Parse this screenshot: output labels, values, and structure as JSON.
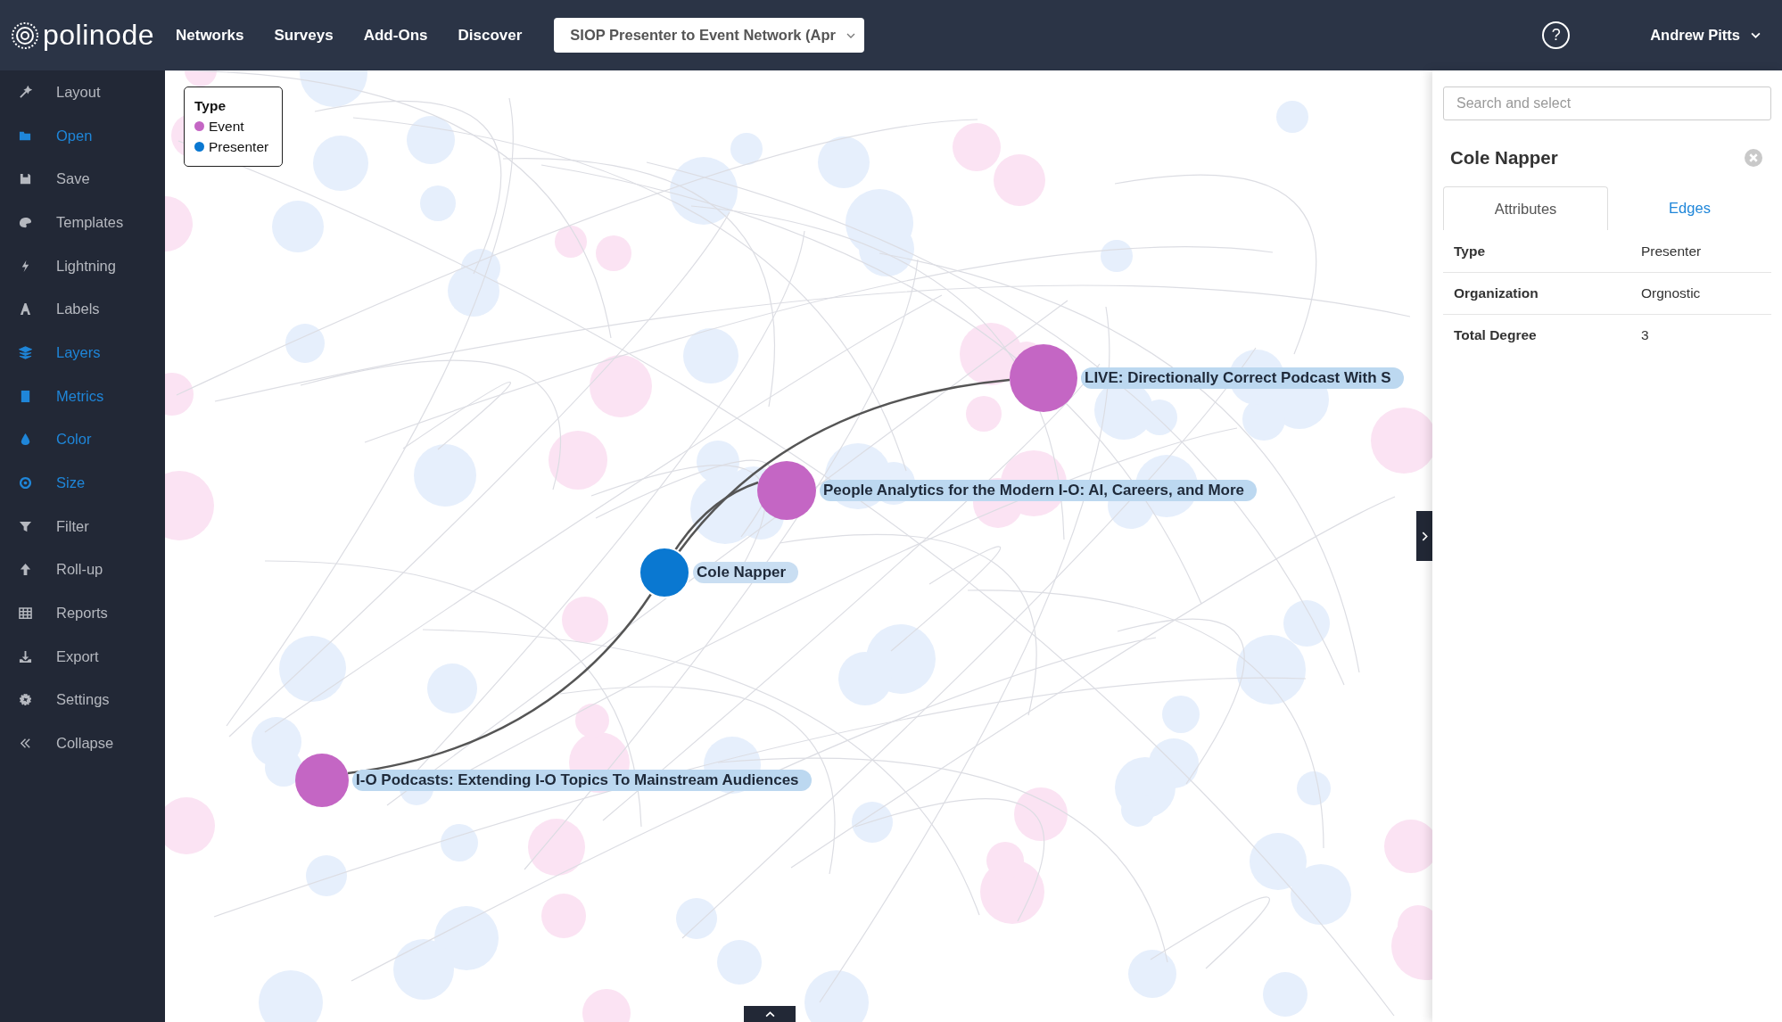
{
  "header": {
    "logo": "polinode",
    "nav": [
      "Networks",
      "Surveys",
      "Add-Ons",
      "Discover"
    ],
    "network_select": "SIOP Presenter to Event Network (Apr",
    "help": "?",
    "user": "Andrew Pitts"
  },
  "sidebar": {
    "items": [
      {
        "label": "Layout",
        "active": false
      },
      {
        "label": "Open",
        "active": true
      },
      {
        "label": "Save",
        "active": false
      },
      {
        "label": "Templates",
        "active": false
      },
      {
        "label": "Lightning",
        "active": false
      },
      {
        "label": "Labels",
        "active": false
      },
      {
        "label": "Layers",
        "active": true
      },
      {
        "label": "Metrics",
        "active": true
      },
      {
        "label": "Color",
        "active": true
      },
      {
        "label": "Size",
        "active": true
      },
      {
        "label": "Filter",
        "active": false
      },
      {
        "label": "Roll-up",
        "active": false
      },
      {
        "label": "Reports",
        "active": false
      },
      {
        "label": "Export",
        "active": false
      },
      {
        "label": "Settings",
        "active": false
      },
      {
        "label": "Collapse",
        "active": false
      }
    ]
  },
  "legend": {
    "title": "Type",
    "items": [
      {
        "label": "Event",
        "kind": "event",
        "color": "#c466c4"
      },
      {
        "label": "Presenter",
        "kind": "presenter",
        "color": "#0a78d1"
      }
    ]
  },
  "graph": {
    "nodes": [
      {
        "label": "LIVE: Directionally Correct Podcast With S",
        "kind": "event"
      },
      {
        "label": "People Analytics for the Modern I-O: AI, Careers, and More",
        "kind": "event"
      },
      {
        "label": "Cole Napper",
        "kind": "presenter",
        "selected": true
      },
      {
        "label": "I-O Podcasts: Extending I-O Topics To Mainstream Audiences",
        "kind": "event"
      }
    ]
  },
  "panel": {
    "search": {
      "placeholder": "Search and select"
    },
    "title": "Cole Napper",
    "tabs": [
      {
        "label": "Attributes",
        "selected": true
      },
      {
        "label": "Edges",
        "selected": false
      }
    ],
    "attributes": [
      {
        "name": "Type",
        "value": "Presenter"
      },
      {
        "name": "Organization",
        "value": "Orgnostic"
      },
      {
        "name": "Total Degree",
        "value": "3"
      }
    ]
  }
}
